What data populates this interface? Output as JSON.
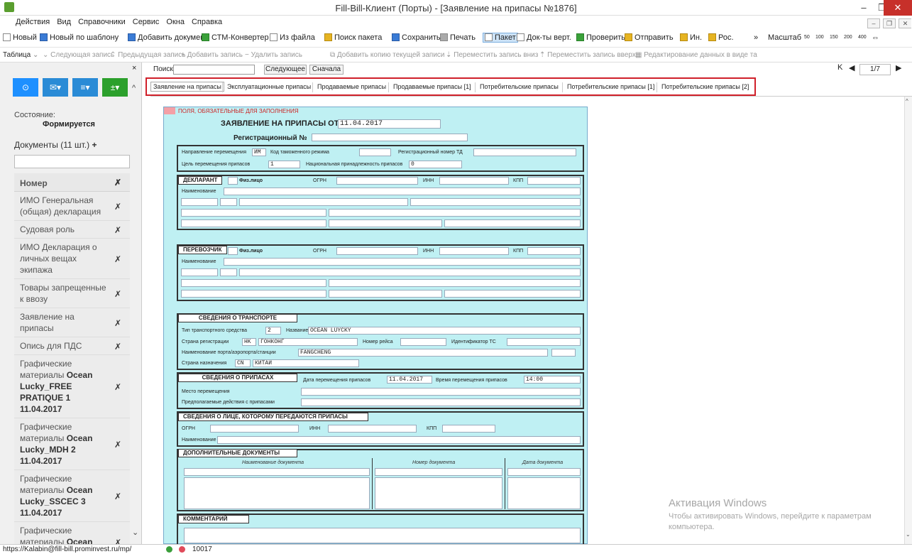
{
  "window": {
    "title": "Fill-Bill-Клиент (Порты) - [Заявление на припасы №1876]",
    "minimize": "–",
    "restore": "❐",
    "close": "✕"
  },
  "menu": {
    "items": [
      "Действия",
      "Вид",
      "Справочники",
      "Сервис",
      "Окна",
      "Справка"
    ]
  },
  "toolbar": {
    "new": "Новый",
    "new_template": "Новый по шаблону",
    "add_document": "Добавить документ",
    "ctm": "СТМ-Конвертер",
    "from_file": "Из файла",
    "search_package": "Поиск пакета",
    "save": "Сохранить",
    "print": "Печать",
    "package": "Пакет",
    "docs_vert": "Док-ты верт.",
    "check": "Проверить",
    "send": "Отправить",
    "in": "Ин.",
    "ros": "Рос.",
    "more": "»",
    "zoom_label": "Масштаб",
    "zoom_levels": [
      "50",
      "100",
      "150",
      "200",
      "400"
    ]
  },
  "toolbar2": {
    "table": "Таблица",
    "next": "Следующая запись",
    "prev": "Предыдущая запись",
    "add": "Добавить запись",
    "delete": "Удалить запись",
    "copy": "Добавить копию текущей записи",
    "move_down": "Переместить запись вниз",
    "move_up": "Переместить запись вверх",
    "edit_table": "Редактирование данных в виде та"
  },
  "left": {
    "close": "×",
    "state_label": "Состояние:",
    "state_value": "Формируется",
    "docs_label": "Документы (11 шт.)",
    "docs_add": "+",
    "list_header": "Номер",
    "list_header_x": "✗",
    "docs": [
      {
        "name": "ИМО Генеральная (общая) декларация"
      },
      {
        "name": "Судовая роль"
      },
      {
        "name": "ИМО Декларация о личных вещах экипажа"
      },
      {
        "name": "Товары запрещенные к ввозу"
      },
      {
        "name": "Заявление на припасы"
      },
      {
        "name": "Опись для ПДС"
      },
      {
        "name": "Графические материалы",
        "bold": "Ocean Lucky_FREE PRATIQUE 1 11.04.2017"
      },
      {
        "name": "Графические материалы",
        "bold": "Ocean Lucky_MDH 2 11.04.2017"
      },
      {
        "name": "Графические материалы",
        "bold": "Ocean Lucky_SSCEC 3 11.04.2017"
      },
      {
        "name": "Графические материалы",
        "bold": "Ocean Lucky_VOYAGE"
      }
    ]
  },
  "search": {
    "label": "Поиск:",
    "next": "Следующее",
    "first": "Сначала"
  },
  "pager": {
    "first": "K",
    "prev": "◀",
    "value": "1/7",
    "next": "▶",
    "last": "▶|"
  },
  "tabs": [
    "Заявление на припасы",
    "Эксплуатационные припасы",
    "Продаваемые припасы",
    "Продаваемые припасы [1]",
    "Потребительские припасы",
    "Потребительские припасы [1]",
    "Потребительские припасы [2]"
  ],
  "form": {
    "required_note": "ПОЛЯ, ОБЯЗАТЕЛЬНЫЕ ДЛЯ ЗАПОЛНЕНИЯ",
    "title": "ЗАЯВЛЕНИЕ НА ПРИПАСЫ  ОТ",
    "date": "11.04.2017",
    "reg_label": "Регистрационный №",
    "s1": {
      "direction_label": "Направление перемещения",
      "direction": "ИМ",
      "customs_label": "Код таможенного режима",
      "reg_td_label": "Регистрационный номер ТД",
      "purpose_label": "Цель перемещения припасов",
      "purpose": "1",
      "nationality_label": "Национальная принадлежность припасов",
      "nationality": "0"
    },
    "declarant": {
      "title": "ДЕКЛАРАНТ",
      "person": "Физ.лицо",
      "ogrn": "ОГРН",
      "inn": "ИНН",
      "kpp": "КПП",
      "name": "Наименование"
    },
    "carrier": {
      "title": "ПЕРЕВОЗЧИК",
      "person": "Физ.лицо",
      "ogrn": "ОГРН",
      "inn": "ИНН",
      "kpp": "КПП",
      "name": "Наименование"
    },
    "transport": {
      "title": "СВЕДЕНИЯ О ТРАНСПОРТЕ",
      "type_label": "Тип транспортного средства",
      "type": "2",
      "name_label": "Название",
      "name": "OCEAN LUYCKY",
      "country_label": "Страна регистрации",
      "country_code": "HK",
      "country": "ГОНКОНГ",
      "voyage_label": "Номер рейса",
      "id_label": "Идентификатор ТС",
      "port_label": "Наименование порта/аэропорта/станции",
      "port": "FANGCHENG",
      "dest_label": "Страна назначения",
      "dest_code": "CN",
      "dest": "КИТАЙ"
    },
    "supplies": {
      "title": "СВЕДЕНИЯ О ПРИПАСАХ",
      "date_label": "Дата перемещения припасов",
      "date": "11.04.2017",
      "time_label": "Время перемещения припасов",
      "time": "14:00",
      "place_label": "Место перемещения",
      "actions_label": "Предполагаемые действия с припасами"
    },
    "recipient": {
      "title": "СВЕДЕНИЯ О ЛИЦЕ, КОТОРОМУ ПЕРЕДАЮТСЯ ПРИПАСЫ",
      "ogrn": "ОГРН",
      "inn": "ИНН",
      "kpp": "КПП",
      "name": "Наименование"
    },
    "extra_docs": {
      "title": "ДОПОЛНИТЕЛЬНЫЕ ДОКУМЕНТЫ",
      "col1": "Наименование документа",
      "col2": "Номер документа",
      "col3": "Дата документа"
    },
    "comment": {
      "title": "КОММЕНТАРИЙ"
    }
  },
  "watermark": {
    "line1": "Активация Windows",
    "line2": "Чтобы активировать Windows, перейдите к параметрам",
    "line3": "компьютера."
  },
  "status": {
    "url": "https://Kalabin@fill-bill.prominvest.ru/mp/",
    "count": "10017"
  },
  "colors": {
    "form_bg": "#bff0f3",
    "highlight": "#d0202a",
    "accent": "#1e90ff"
  }
}
